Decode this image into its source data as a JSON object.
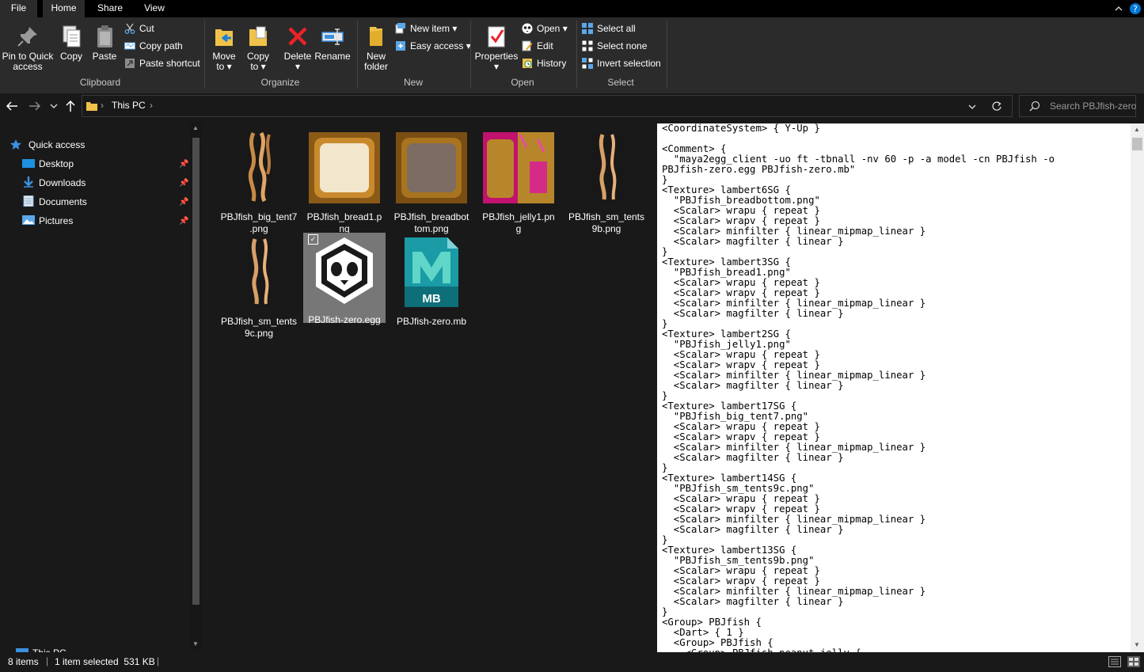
{
  "tabs": {
    "file": "File",
    "home": "Home",
    "share": "Share",
    "view": "View"
  },
  "ribbon": {
    "clipboard": {
      "group_label": "Clipboard",
      "pin_label_1": "Pin to Quick",
      "pin_label_2": "access",
      "copy": "Copy",
      "paste": "Paste",
      "cut": "Cut",
      "copy_path": "Copy path",
      "paste_shortcut": "Paste shortcut"
    },
    "organize": {
      "group_label": "Organize",
      "move_to_1": "Move",
      "move_to_2": "to",
      "copy_to_1": "Copy",
      "copy_to_2": "to",
      "delete": "Delete",
      "rename": "Rename"
    },
    "new": {
      "group_label": "New",
      "new_folder_1": "New",
      "new_folder_2": "folder",
      "new_item": "New item",
      "easy_access": "Easy access"
    },
    "open": {
      "group_label": "Open",
      "properties": "Properties",
      "open": "Open",
      "edit": "Edit",
      "history": "History"
    },
    "select": {
      "group_label": "Select",
      "select_all": "Select all",
      "select_none": "Select none",
      "invert_selection": "Invert selection"
    }
  },
  "address": {
    "location": "This PC",
    "search_placeholder": "Search PBJfish-zero"
  },
  "nav_pane": {
    "quick_access": "Quick access",
    "items": [
      "Desktop",
      "Downloads",
      "Documents",
      "Pictures"
    ],
    "this_pc": "This PC"
  },
  "files": [
    {
      "line1": "PBJfish_big_tent7",
      "line2": ".png",
      "thumb": "tentacle"
    },
    {
      "line1": "PBJfish_bread1.p",
      "line2": "ng",
      "thumb": "bread-light"
    },
    {
      "line1": "PBJfish_breadbot",
      "line2": "tom.png",
      "thumb": "bread-dark"
    },
    {
      "line1": "PBJfish_jelly1.pn",
      "line2": "g",
      "thumb": "jelly"
    },
    {
      "line1": "PBJfish_sm_tents",
      "line2": "9b.png",
      "thumb": "tentacle"
    },
    {
      "line1": "PBJfish_sm_tents",
      "line2": "9c.png",
      "thumb": "tentacle"
    },
    {
      "line1": "PBJfish-zero.egg",
      "line2": "",
      "thumb": "panda",
      "selected": true
    },
    {
      "line1": "PBJfish-zero.mb",
      "line2": "",
      "thumb": "maya",
      "badge": "MB"
    }
  ],
  "preview_text": "<CoordinateSystem> { Y-Up }\n\n<Comment> {\n  \"maya2egg_client -uo ft -tbnall -nv 60 -p -a model -cn PBJfish -o\nPBJfish-zero.egg PBJfish-zero.mb\"\n}\n<Texture> lambert6SG {\n  \"PBJfish_breadbottom.png\"\n  <Scalar> wrapu { repeat }\n  <Scalar> wrapv { repeat }\n  <Scalar> minfilter { linear_mipmap_linear }\n  <Scalar> magfilter { linear }\n}\n<Texture> lambert3SG {\n  \"PBJfish_bread1.png\"\n  <Scalar> wrapu { repeat }\n  <Scalar> wrapv { repeat }\n  <Scalar> minfilter { linear_mipmap_linear }\n  <Scalar> magfilter { linear }\n}\n<Texture> lambert2SG {\n  \"PBJfish_jelly1.png\"\n  <Scalar> wrapu { repeat }\n  <Scalar> wrapv { repeat }\n  <Scalar> minfilter { linear_mipmap_linear }\n  <Scalar> magfilter { linear }\n}\n<Texture> lambert17SG {\n  \"PBJfish_big_tent7.png\"\n  <Scalar> wrapu { repeat }\n  <Scalar> wrapv { repeat }\n  <Scalar> minfilter { linear_mipmap_linear }\n  <Scalar> magfilter { linear }\n}\n<Texture> lambert14SG {\n  \"PBJfish_sm_tents9c.png\"\n  <Scalar> wrapu { repeat }\n  <Scalar> wrapv { repeat }\n  <Scalar> minfilter { linear_mipmap_linear }\n  <Scalar> magfilter { linear }\n}\n<Texture> lambert13SG {\n  \"PBJfish_sm_tents9b.png\"\n  <Scalar> wrapu { repeat }\n  <Scalar> wrapv { repeat }\n  <Scalar> minfilter { linear_mipmap_linear }\n  <Scalar> magfilter { linear }\n}\n<Group> PBJfish {\n  <Dart> { 1 }\n  <Group> PBJfish {\n    <Group> PBJfish_peanut_jelly {",
  "status": {
    "item_count": "8 items",
    "selection": "1 item selected  531 KB"
  },
  "colors": {
    "ribbon_bg": "#2b2b2b",
    "window_bg": "#191919",
    "accent_blue": "#0078d7",
    "selection_bg": "#777777"
  }
}
